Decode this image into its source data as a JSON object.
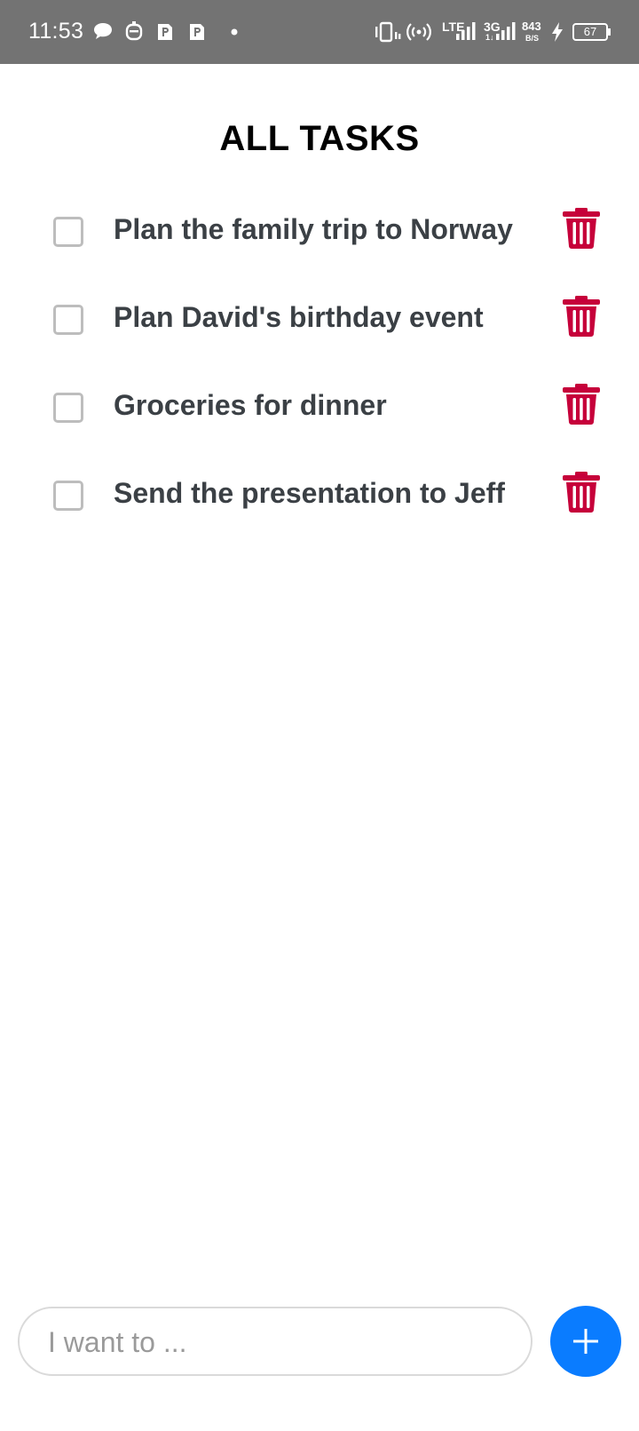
{
  "status_bar": {
    "time": "11:53",
    "net1": "LTE",
    "net2": "3G",
    "net2_sub": "1↓",
    "speed_value": "843",
    "speed_unit": "B/S",
    "battery": "67"
  },
  "screen": {
    "title": "ALL TASKS"
  },
  "tasks": [
    {
      "label": "Plan the family trip to Norway",
      "checked": false
    },
    {
      "label": "Plan David's birthday event",
      "checked": false
    },
    {
      "label": "Groceries for dinner",
      "checked": false
    },
    {
      "label": "Send the presentation to Jeff",
      "checked": false
    }
  ],
  "composer": {
    "placeholder": "I want to ..."
  },
  "colors": {
    "delete": "#c6003a",
    "accent": "#0a7cff",
    "status_bar": "#737373"
  },
  "icons": [
    "chat-bubble-icon",
    "robot-icon",
    "app-p-icon",
    "vibrate-icon",
    "hotspot-icon",
    "signal-icon",
    "charging-icon",
    "battery-icon",
    "trash-icon",
    "plus-icon"
  ]
}
